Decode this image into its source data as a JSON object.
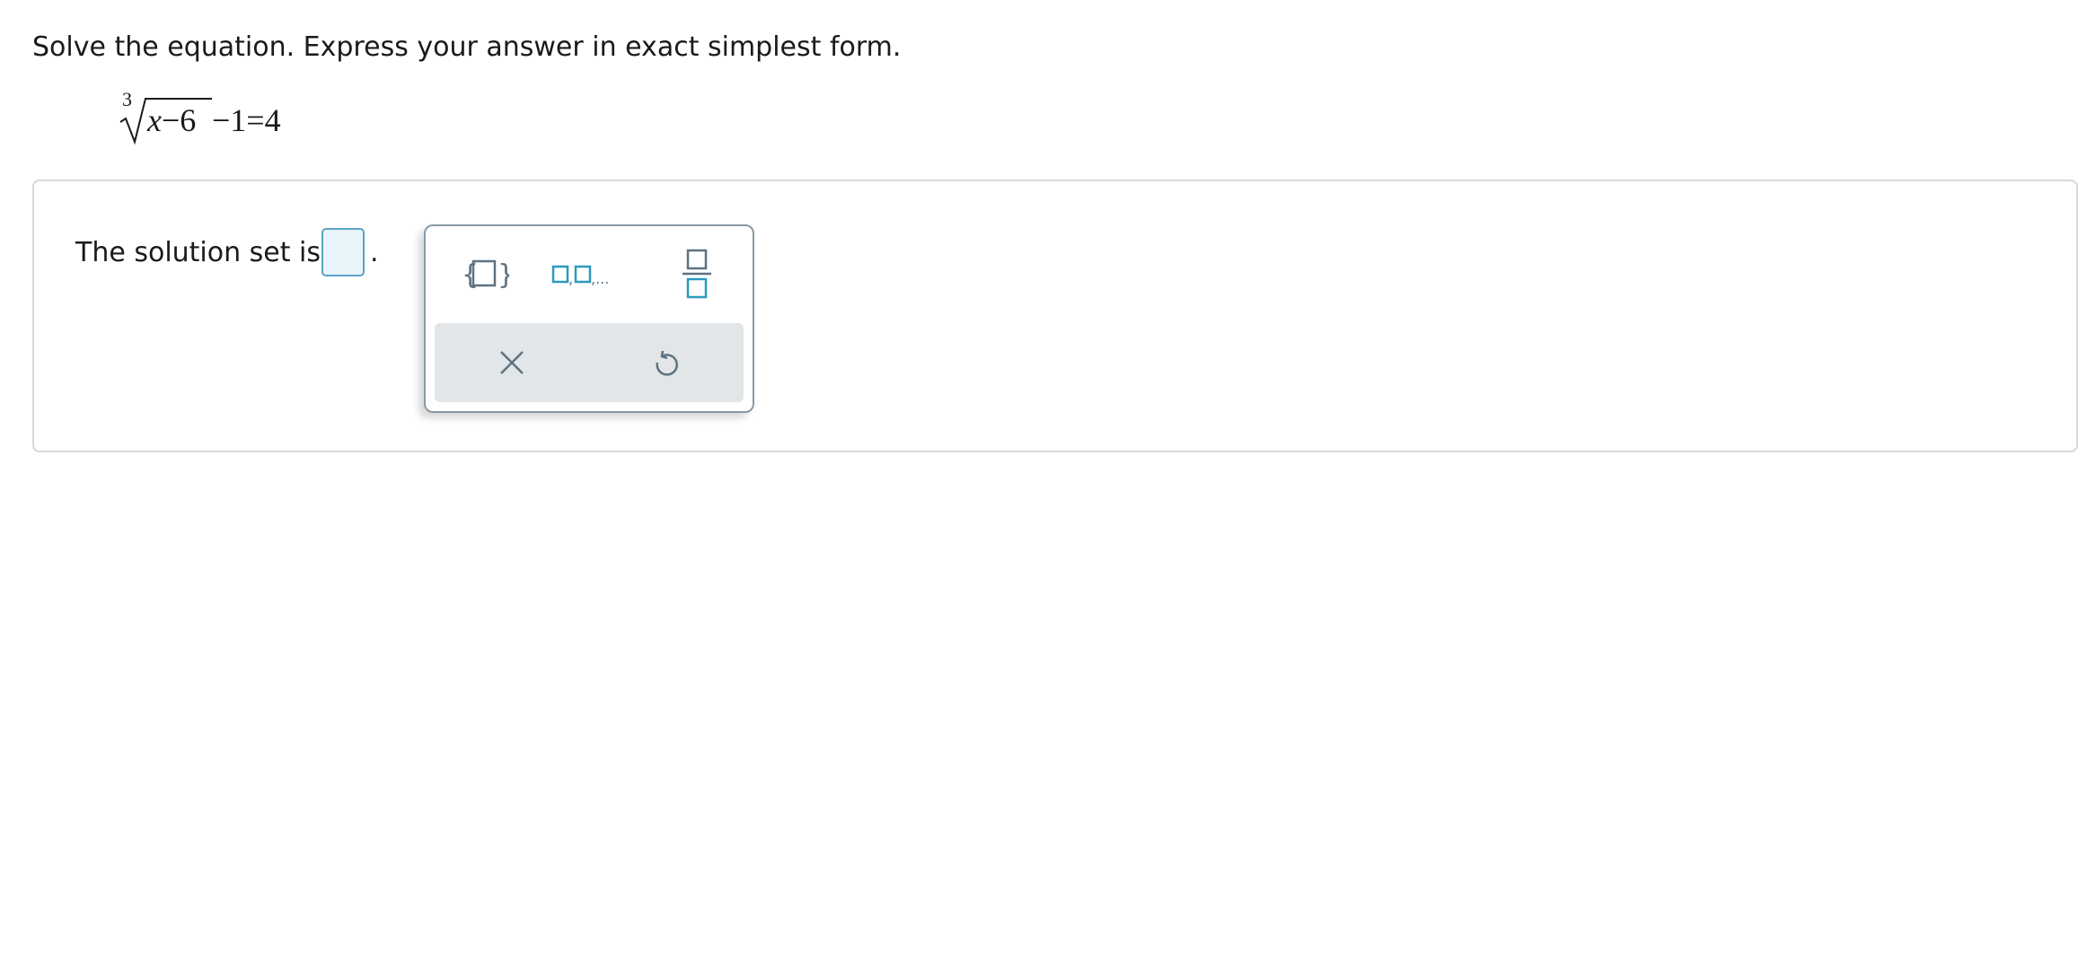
{
  "question": {
    "instructions": "Solve the equation. Express your answer in exact simplest form.",
    "equation": {
      "root_index": "3",
      "radicand_var": "x",
      "radicand_rest": "−6",
      "rest": "−1=4"
    }
  },
  "answer": {
    "prompt": "The solution set is",
    "period": ".",
    "input_value": ""
  },
  "palette": {
    "tools": [
      {
        "icon": "set-braces-icon"
      },
      {
        "icon": "list-icon"
      },
      {
        "icon": "fraction-icon"
      }
    ],
    "actions": [
      {
        "icon": "close-icon"
      },
      {
        "icon": "undo-icon"
      }
    ]
  },
  "colors": {
    "text": "#1a1a1a",
    "accent": "#5ba3c7",
    "answer_box_bg": "#e9f4fb",
    "panel_border": "#d9d9d9",
    "palette_border": "#8a9aa6",
    "action_bar_bg": "#e2e6e8",
    "icon_gray": "#5e7281"
  }
}
